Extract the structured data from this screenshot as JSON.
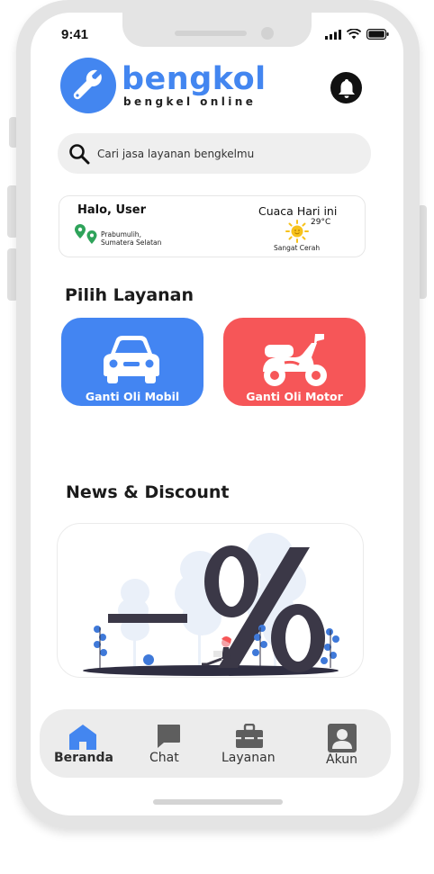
{
  "status": {
    "time": "9:41"
  },
  "logo": {
    "title": "bengkol",
    "subtitle": "bengkel online"
  },
  "search": {
    "placeholder": "Cari jasa layanan bengkelmu"
  },
  "greeting": {
    "hello": "Halo, User",
    "location_line1": "Prabumulih,",
    "location_line2": "Sumatera Selatan",
    "weather_title": "Cuaca Hari ini",
    "temperature": "29°C",
    "weather_desc": "Sangat Cerah"
  },
  "services": {
    "title": "Pilih Layanan",
    "items": [
      {
        "label": "Ganti Oli Mobil",
        "icon": "car-icon",
        "color": "#4385f2"
      },
      {
        "label": "Ganti Oli Motor",
        "icon": "motorcycle-icon",
        "color": "#f65658"
      }
    ]
  },
  "news": {
    "title": "News & Discount",
    "banner_icon": "discount-illustration"
  },
  "nav": {
    "items": [
      {
        "label": "Beranda",
        "icon": "home-icon",
        "active": true
      },
      {
        "label": "Chat",
        "icon": "chat-icon",
        "active": false
      },
      {
        "label": "Layanan",
        "icon": "toolbox-icon",
        "active": false
      },
      {
        "label": "Akun",
        "icon": "account-icon",
        "active": false
      }
    ]
  },
  "colors": {
    "primary": "#4386f0",
    "danger": "#f65658",
    "nav_inactive": "#5e5e5e",
    "dark": "#3b3847"
  }
}
